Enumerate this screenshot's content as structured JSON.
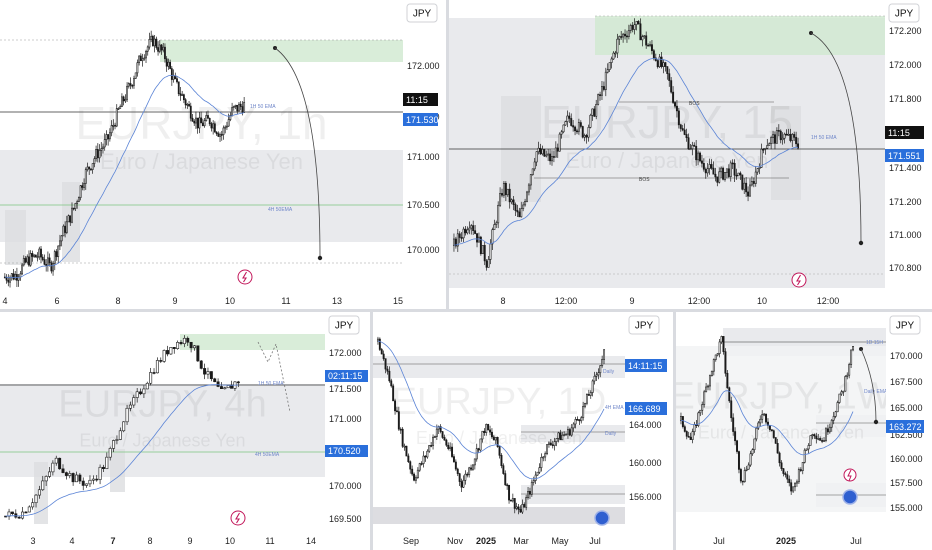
{
  "colors": {
    "candle": "#1a1a1a",
    "grid_zone": "#d6d8dc",
    "demand_zone": "#c9e6c9",
    "ema_line": "#5b84d6",
    "ema_green": "#7bc47f",
    "price_box": "#2a6fdb",
    "time_box": "#111111"
  },
  "chart_data": [
    {
      "type": "candlestick",
      "panel": "top-left",
      "watermark_symbol": "EURJPY, 1h",
      "watermark_name": "Euro / Japanese Yen",
      "currency": "JPY",
      "x_ticks": [
        "4",
        "6",
        "8",
        "9",
        "10",
        "11",
        "13",
        "15"
      ],
      "y_ticks": [
        "172.000",
        "171.500",
        "171.000",
        "170.500",
        "170.000"
      ],
      "ylim": [
        169.75,
        172.5
      ],
      "labels": {
        "ema_top": "1H 50 EMA",
        "ema_low": "4H 50EMA"
      },
      "last_time_label": "11:15",
      "last_price_label": "171.530",
      "close_path": [
        169.88,
        169.9,
        170.05,
        170.1,
        169.98,
        170.3,
        170.55,
        170.9,
        171.1,
        171.25,
        171.55,
        171.8,
        172.1,
        172.25,
        172.1,
        171.8,
        171.6,
        171.4,
        171.45,
        171.3,
        171.55,
        171.6
      ],
      "projection_target": 169.9
    },
    {
      "type": "candlestick",
      "panel": "top-right",
      "watermark_symbol": "EURJPY, 15",
      "watermark_name": "Euro / Japanese Yen",
      "currency": "JPY",
      "x_ticks": [
        "8",
        "12:00",
        "9",
        "12:00",
        "10",
        "12:00"
      ],
      "y_ticks": [
        "172.200",
        "172.000",
        "171.800",
        "171.600",
        "171.400",
        "171.200",
        "171.000",
        "170.800"
      ],
      "ylim": [
        170.7,
        172.3
      ],
      "labels": {
        "bos_top": "BOS",
        "bos_low": "BOS",
        "ema": "1H 50 EMA"
      },
      "last_time_label": "11:15",
      "last_price_label": "171.551",
      "close_path": [
        170.95,
        171.1,
        170.85,
        171.3,
        171.1,
        171.5,
        171.45,
        171.7,
        171.6,
        171.85,
        172.15,
        172.25,
        172.1,
        171.95,
        171.6,
        171.45,
        171.35,
        171.4,
        171.25,
        171.55,
        171.6,
        171.55
      ],
      "projection_target": 170.95
    },
    {
      "type": "candlestick",
      "panel": "bottom-left",
      "watermark_symbol": "EURJPY, 4h",
      "watermark_name": "Euro / Japanese Yen",
      "currency": "JPY",
      "x_ticks": [
        "3",
        "4",
        "7",
        "8",
        "9",
        "10",
        "11",
        "14"
      ],
      "y_ticks": [
        "172.000",
        "171.500",
        "171.000",
        "170.500",
        "170.000",
        "169.500"
      ],
      "ylim": [
        169.35,
        172.3
      ],
      "labels": {
        "ema_top": "1H 50 EMA",
        "ema_low": "4H 50EMA"
      },
      "last_time_label": "02:11:15",
      "last_price_label": "170.520",
      "close_path": [
        169.55,
        169.6,
        169.9,
        170.35,
        170.1,
        170.0,
        170.3,
        170.9,
        171.3,
        171.7,
        172.0,
        172.1,
        171.6,
        171.3,
        171.5
      ]
    },
    {
      "type": "candlestick",
      "panel": "bottom-middle",
      "watermark_symbol": "EURJPY, 1D",
      "watermark_name": "Euro / Japanese Yen",
      "currency": "JPY",
      "x_ticks": [
        "Sep",
        "Nov",
        "2025",
        "Mar",
        "May",
        "Jul"
      ],
      "y_ticks": [
        "168.000",
        "164.000",
        "160.000",
        "156.000"
      ],
      "ylim": [
        154.5,
        172.0
      ],
      "labels": {
        "tag1": "Daily",
        "tag2": "4H EMA",
        "tag3": "Daily"
      },
      "last_time_label": "14:11:15",
      "last_price_label": "166.689",
      "close_path": [
        170.5,
        167.0,
        162.0,
        158.5,
        160.5,
        163.0,
        161.0,
        158.0,
        160.0,
        163.0,
        161.5,
        157.0,
        155.5,
        158.0,
        161.0,
        162.0,
        162.5,
        164.0,
        166.5,
        169.5
      ]
    },
    {
      "type": "candlestick",
      "panel": "bottom-right",
      "watermark_symbol": "EURJPY, 1W",
      "watermark_name": "Euro / Japanese Yen",
      "currency": "JPY",
      "x_ticks": [
        "Jul",
        "2025",
        "Jul"
      ],
      "y_ticks": [
        "170.000",
        "167.500",
        "165.000",
        "162.500",
        "160.000",
        "157.500",
        "155.000"
      ],
      "ylim": [
        154.0,
        172.5
      ],
      "labels": {
        "tag1": "1D 15H",
        "tag2": "Daily EMA"
      },
      "last_price_label": "163.272",
      "close_path": [
        163.0,
        161.0,
        164.5,
        168.0,
        171.0,
        163.0,
        157.0,
        160.0,
        164.0,
        162.0,
        158.0,
        156.0,
        159.0,
        162.0,
        161.0,
        163.5,
        166.0,
        170.5
      ],
      "projection_target": 164.0
    }
  ]
}
